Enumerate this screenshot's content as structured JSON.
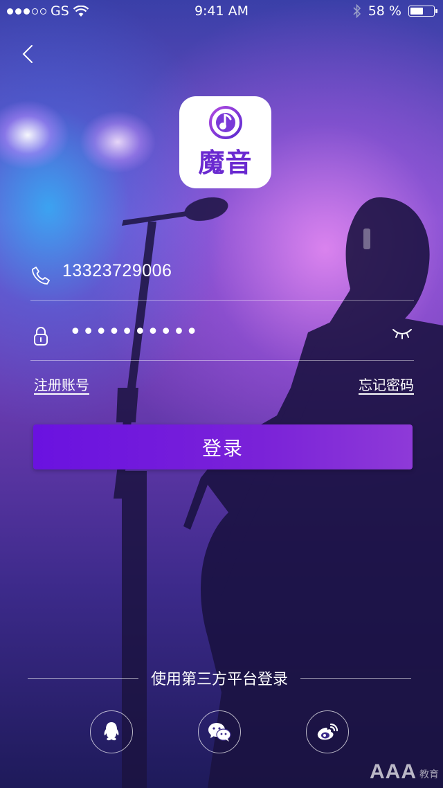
{
  "status_bar": {
    "carrier": "GS",
    "time": "9:41 AM",
    "battery_percent": "58 %",
    "battery_level": 0.58
  },
  "logo": {
    "app_name": "魔音"
  },
  "login_form": {
    "phone_value": "13323729006",
    "password_value": "••••••••••"
  },
  "links": {
    "register": "注册账号",
    "forgot_password": "忘记密码"
  },
  "login_button": "登录",
  "third_party": {
    "label": "使用第三方平台登录",
    "providers": [
      "qq-icon",
      "wechat-icon",
      "weibo-icon"
    ]
  },
  "watermark": {
    "big": "AAA",
    "small": "教育"
  },
  "colors": {
    "accent": "#7a22d8",
    "logo_text": "#6a2ad0"
  }
}
